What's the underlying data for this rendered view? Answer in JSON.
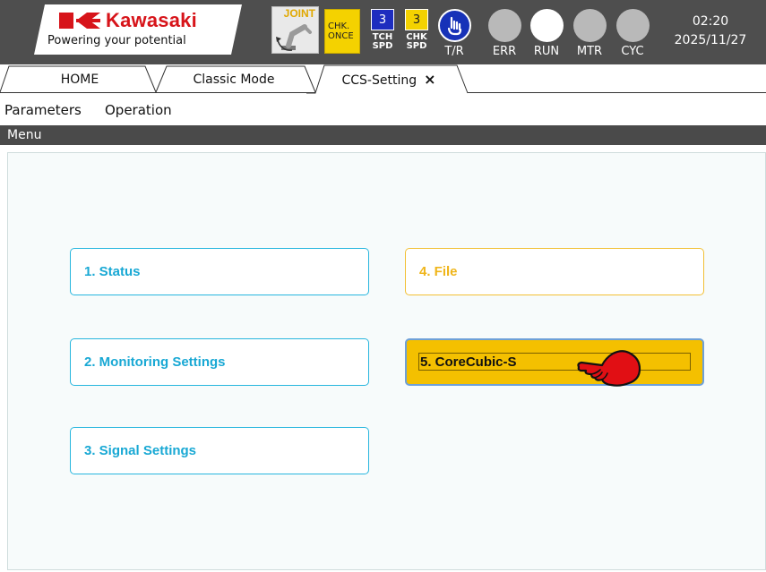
{
  "header": {
    "brand": "Kawasaki",
    "tagline": "Powering your potential",
    "mode_label": "JOINT",
    "check_once_line1": "CHK.",
    "check_once_line2": "ONCE",
    "teach_speed": {
      "value": "3",
      "caption_line1": "TCH",
      "caption_line2": "SPD"
    },
    "check_speed": {
      "value": "3",
      "caption_line1": "CHK",
      "caption_line2": "SPD"
    },
    "lamps": [
      "T/R",
      "ERR",
      "RUN",
      "MTR",
      "CYC"
    ],
    "time": "02:20",
    "date": "2025/11/27",
    "colors": {
      "brand_red": "#d7141a",
      "topbar": "#4e4e4e",
      "tr_lamp": "#1732b8",
      "speed_blue": "#1d2dbf",
      "speed_yellow": "#f4d200"
    }
  },
  "tabs": [
    {
      "label": "HOME"
    },
    {
      "label": "Classic Mode"
    },
    {
      "label": "CCS-Setting",
      "close_icon": "×",
      "active": true
    }
  ],
  "menubar": [
    "Parameters",
    "Operation"
  ],
  "menu_header": "Menu",
  "menu_items": [
    {
      "label": "1. Status",
      "style": "cyan"
    },
    {
      "label": "2. Monitoring Settings",
      "style": "cyan"
    },
    {
      "label": "3. Signal Settings",
      "style": "cyan"
    },
    {
      "label": "4. File",
      "style": "orange"
    },
    {
      "label": "5. CoreCubic-S",
      "style": "selected"
    }
  ],
  "icons": [
    "kawasaki-logo-icon",
    "robot-arm-icon",
    "hand-pointer-icon",
    "close-icon",
    "pointing-hand-cursor-icon"
  ]
}
